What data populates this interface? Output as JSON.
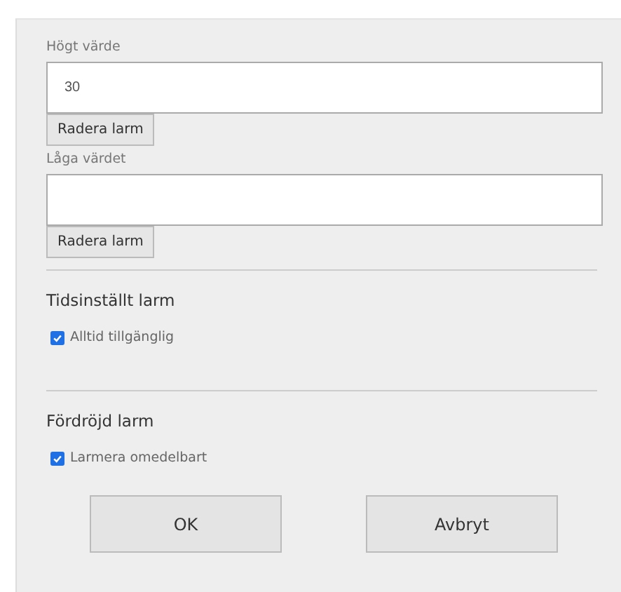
{
  "thresholds": [
    {
      "label": "Högt värde",
      "value": "30",
      "button": "Radera larm"
    },
    {
      "label": "Låga värdet",
      "button": "Radera larm"
    }
  ],
  "sections": [
    {
      "heading": "Tidsinställt larm",
      "option": {
        "label": "Alltid tillgänglig",
        "checked": true
      }
    },
    {
      "heading": "Fördröjd larm",
      "option": {
        "label": "Larmera omedelbart",
        "checked": true
      }
    }
  ],
  "buttons": [
    "OK",
    "Avbryt"
  ]
}
